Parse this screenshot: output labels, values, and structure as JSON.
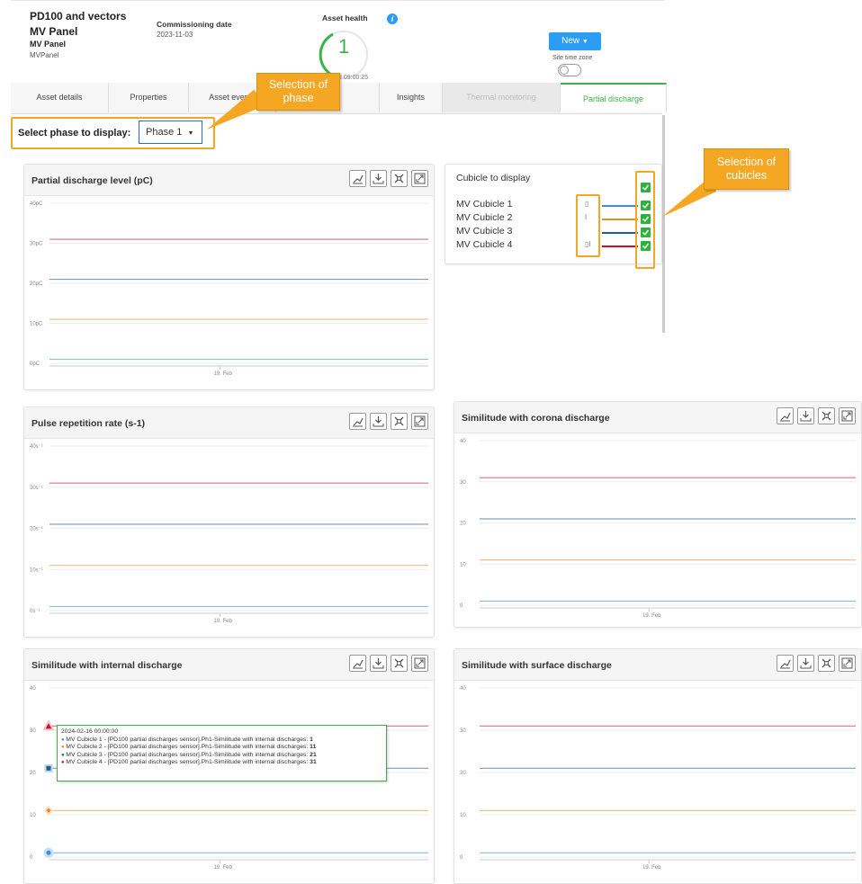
{
  "header": {
    "asset_title": "PD100 and vectors",
    "panel_title": "MV Panel",
    "panel_sub": "MV Panel",
    "panel_code": "MVPanel",
    "commissioning_label": "Commissioning date",
    "commissioning_value": "2023-11-03",
    "health_label": "Asset health",
    "health_value": "1",
    "health_time": "2 09:00:25",
    "new_button": "New",
    "site_tz_label": "Site time zone"
  },
  "tabs": [
    {
      "label": "Asset details",
      "state": "normal"
    },
    {
      "label": "Properties",
      "state": "normal"
    },
    {
      "label": "Asset events",
      "state": "normal"
    },
    {
      "label": "Insights",
      "state": "normal"
    },
    {
      "label": "Thermal monitoring",
      "state": "disabled"
    },
    {
      "label": "Partial discharge",
      "state": "active"
    }
  ],
  "phase_selector": {
    "label": "Select phase to display:",
    "value": "Phase 1"
  },
  "callouts": {
    "phase": "Selection of phase",
    "cubicles": "Selection of cubicles"
  },
  "cubicle_panel": {
    "title": "Cubicle to display",
    "cubicles": [
      {
        "name": "MV Cubicle 1",
        "color": "#3d8fd6",
        "checked": true
      },
      {
        "name": "MV Cubicle 2",
        "color": "#e98a2b",
        "checked": true
      },
      {
        "name": "MV Cubicle 3",
        "color": "#1a5e9a",
        "checked": true
      },
      {
        "name": "MV Cubicle 4",
        "color": "#c8102e",
        "checked": true
      }
    ]
  },
  "colors": {
    "accent_green": "#3cb34a",
    "button_blue": "#2a9df4",
    "callout_orange": "#f5a623"
  },
  "charts": {
    "pd_level": {
      "title": "Partial discharge level (pC)"
    },
    "pulse_rate": {
      "title": "Pulse repetition rate (s-1)"
    },
    "corona": {
      "title": "Similitude with corona discharge"
    },
    "internal": {
      "title": "Similitude with internal discharge"
    },
    "surface": {
      "title": "Similitude with surface discharge"
    }
  },
  "tooltip": {
    "date": "2024-02-16 00:00:00",
    "rows": [
      {
        "text": "MV Cubicle 1 - [PD100 partial discharges sensor].Ph1-Similitude with internal discharges: ",
        "value": "1",
        "color": "#3d8fd6"
      },
      {
        "text": "MV Cubicle 2 - [PD100 partial discharges sensor].Ph1-Similitude with internal discharges: ",
        "value": "11",
        "color": "#e98a2b"
      },
      {
        "text": "MV Cubicle 3 - [PD100 partial discharges sensor].Ph1-Similitude with internal discharges: ",
        "value": "21",
        "color": "#1a5e9a"
      },
      {
        "text": "MV Cubicle 4 - [PD100 partial discharges sensor].Ph1-Similitude with internal discharges: ",
        "value": "31",
        "color": "#c8102e"
      }
    ]
  },
  "chart_data": [
    {
      "type": "line",
      "title": "Partial discharge level (pC)",
      "ylim": [
        0,
        40
      ],
      "yticks": [
        "0pC",
        "10pC",
        "20pC",
        "30pC",
        "40pC"
      ],
      "x": [
        "19. Feb"
      ],
      "series": [
        {
          "name": "MV Cubicle 1",
          "values": [
            1
          ]
        },
        {
          "name": "MV Cubicle 2",
          "values": [
            11
          ]
        },
        {
          "name": "MV Cubicle 3",
          "values": [
            21
          ]
        },
        {
          "name": "MV Cubicle 4",
          "values": [
            31
          ]
        }
      ]
    },
    {
      "type": "line",
      "title": "Pulse repetition rate (s-1)",
      "ylim": [
        0,
        40
      ],
      "yticks": [
        "0s⁻¹",
        "10s⁻¹",
        "20s⁻¹",
        "30s⁻¹",
        "40s⁻¹"
      ],
      "x": [
        "19. Feb"
      ],
      "series": [
        {
          "name": "MV Cubicle 1",
          "values": [
            1
          ]
        },
        {
          "name": "MV Cubicle 2",
          "values": [
            11
          ]
        },
        {
          "name": "MV Cubicle 3",
          "values": [
            21
          ]
        },
        {
          "name": "MV Cubicle 4",
          "values": [
            31
          ]
        }
      ]
    },
    {
      "type": "line",
      "title": "Similitude with corona discharge",
      "ylim": [
        0,
        40
      ],
      "yticks": [
        "0",
        "10",
        "20",
        "30",
        "40"
      ],
      "x": [
        "19. Feb"
      ],
      "series": [
        {
          "name": "MV Cubicle 1",
          "values": [
            1
          ]
        },
        {
          "name": "MV Cubicle 2",
          "values": [
            11
          ]
        },
        {
          "name": "MV Cubicle 3",
          "values": [
            21
          ]
        },
        {
          "name": "MV Cubicle 4",
          "values": [
            31
          ]
        }
      ]
    },
    {
      "type": "line",
      "title": "Similitude with internal discharge",
      "ylim": [
        0,
        40
      ],
      "yticks": [
        "0",
        "10",
        "20",
        "30",
        "40"
      ],
      "x": [
        "19. Feb"
      ],
      "series": [
        {
          "name": "MV Cubicle 1",
          "values": [
            1
          ]
        },
        {
          "name": "MV Cubicle 2",
          "values": [
            11
          ]
        },
        {
          "name": "MV Cubicle 3",
          "values": [
            21
          ]
        },
        {
          "name": "MV Cubicle 4",
          "values": [
            31
          ]
        }
      ]
    },
    {
      "type": "line",
      "title": "Similitude with surface discharge",
      "ylim": [
        0,
        40
      ],
      "yticks": [
        "0",
        "10",
        "20",
        "30",
        "40"
      ],
      "x": [
        "19. Feb"
      ],
      "series": [
        {
          "name": "MV Cubicle 1",
          "values": [
            1
          ]
        },
        {
          "name": "MV Cubicle 2",
          "values": [
            11
          ]
        },
        {
          "name": "MV Cubicle 3",
          "values": [
            21
          ]
        },
        {
          "name": "MV Cubicle 4",
          "values": [
            31
          ]
        }
      ]
    }
  ]
}
